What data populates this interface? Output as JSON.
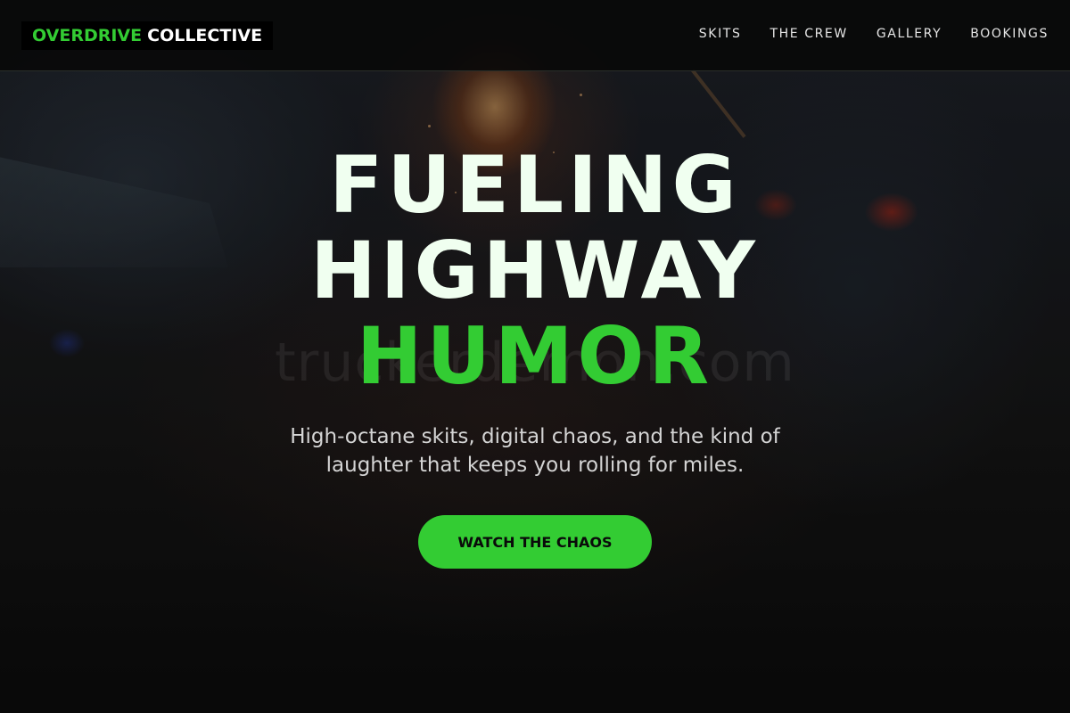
{
  "header": {
    "logo": {
      "accent": "OVERDRIVE",
      "rest": "COLLECTIVE"
    },
    "nav": [
      {
        "label": "SKITS"
      },
      {
        "label": "THE CREW"
      },
      {
        "label": "GALLERY"
      },
      {
        "label": "BOOKINGS"
      }
    ]
  },
  "hero": {
    "headline": [
      "FUELING",
      "HIGHWAY",
      "HUMOR"
    ],
    "subtext": "High-octane skits, digital chaos, and the kind of laughter that keeps you rolling for miles.",
    "cta_label": "WATCH THE CHAOS",
    "watermark": "truckerdemon.com"
  },
  "colors": {
    "accent": "#33cc33",
    "headline": "#f0fff0",
    "header_bg": "#080808"
  }
}
